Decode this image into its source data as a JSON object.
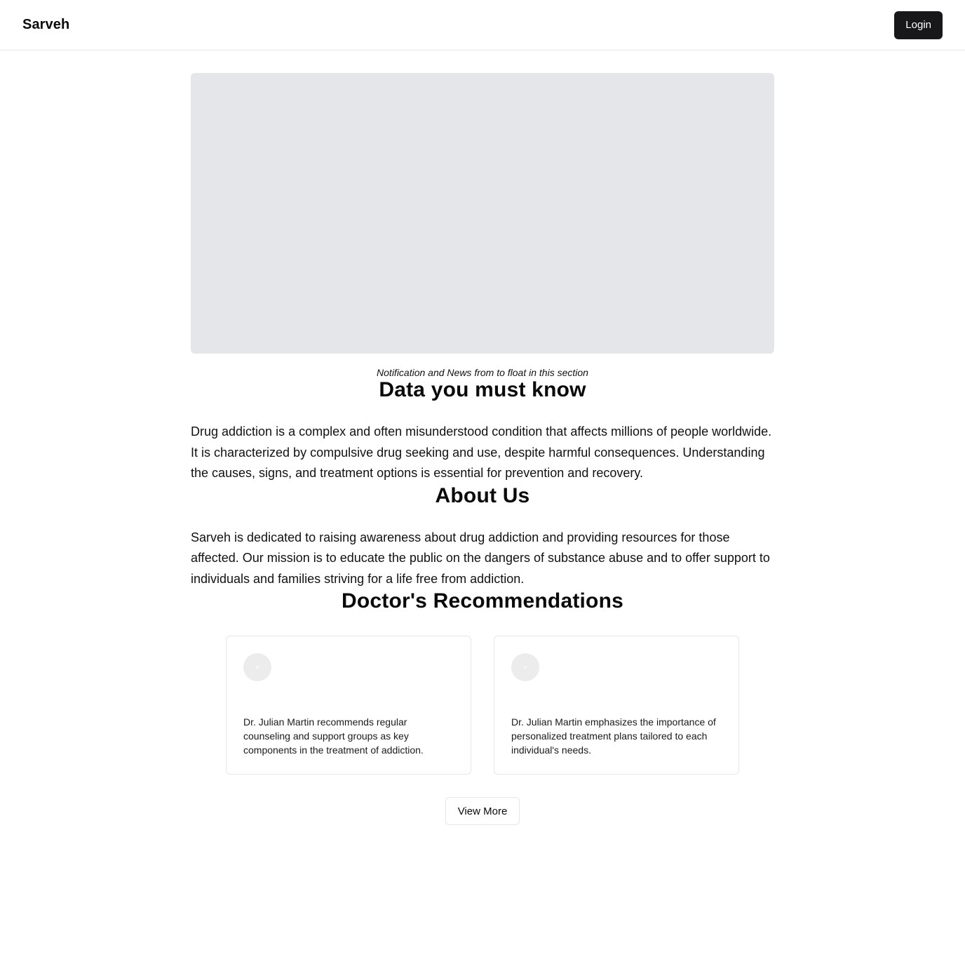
{
  "header": {
    "brand": "Sarveh",
    "login_label": "Login"
  },
  "hero": {
    "caption": "Notification and News from to float in this section"
  },
  "data_section": {
    "title": "Data you must know",
    "text": "Drug addiction is a complex and often misunderstood condition that affects millions of people worldwide. It is characterized by compulsive drug seeking and use, despite harmful consequences. Understanding the causes, signs, and treatment options is essential for prevention and recovery."
  },
  "about_section": {
    "title": "About Us",
    "text": "Sarveh is dedicated to raising awareness about drug addiction and providing resources for those affected. Our mission is to educate the public on the dangers of substance abuse and to offer support to individuals and families striving for a life free from addiction."
  },
  "recommendations": {
    "title": "Doctor's Recommendations",
    "cards": [
      {
        "text": "Dr. Julian Martin recommends regular counseling and support groups as key components in the treatment of addiction."
      },
      {
        "text": "Dr. Julian Martin emphasizes the importance of personalized treatment plans tailored to each individual's needs."
      }
    ],
    "view_more_label": "View More"
  },
  "colors": {
    "primary_button": "#18181b",
    "placeholder": "#e4e6ea",
    "border": "#e5e7eb"
  }
}
